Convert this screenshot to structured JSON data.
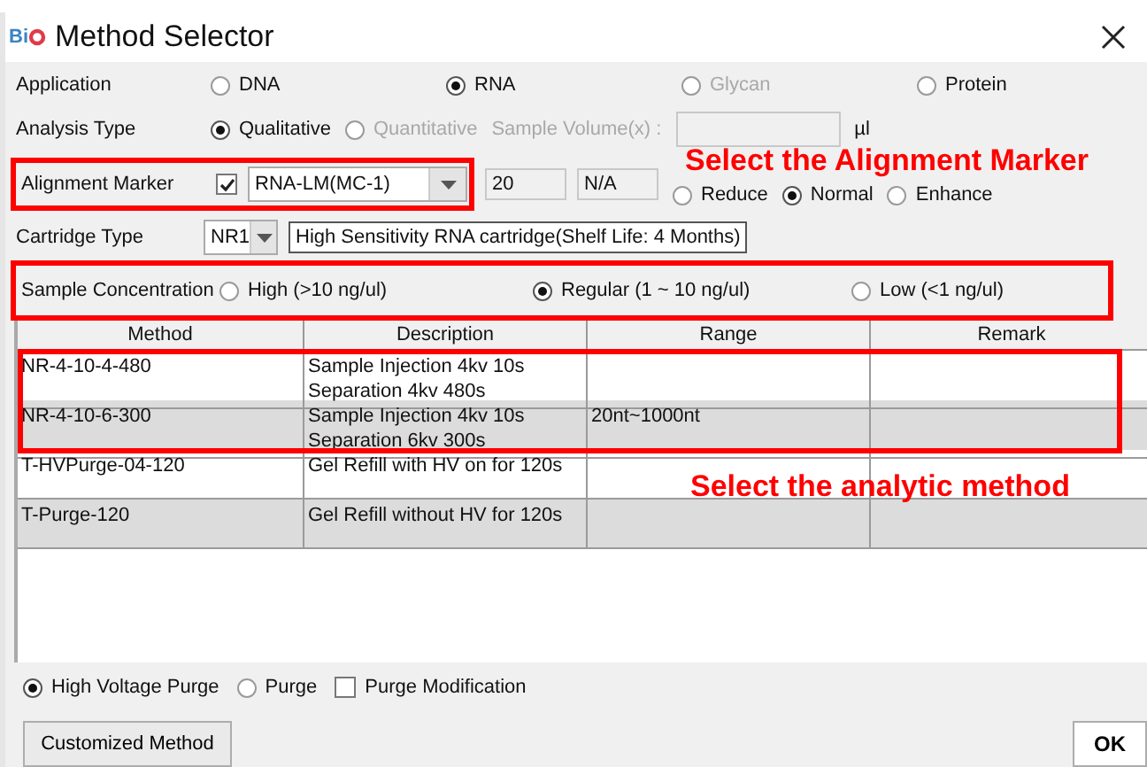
{
  "window": {
    "logo": "Bi",
    "title": "Method Selector"
  },
  "application": {
    "label": "Application",
    "options": [
      {
        "label": "DNA",
        "selected": false,
        "disabled": false
      },
      {
        "label": "RNA",
        "selected": true,
        "disabled": false
      },
      {
        "label": "Glycan",
        "selected": false,
        "disabled": true
      },
      {
        "label": "Protein",
        "selected": false,
        "disabled": false
      }
    ]
  },
  "analysis_type": {
    "label": "Analysis Type",
    "options": [
      {
        "label": "Qualitative",
        "selected": true,
        "disabled": false
      },
      {
        "label": "Quantitative",
        "selected": false,
        "disabled": true
      }
    ],
    "sample_volume": {
      "label": "Sample Volume(x) :",
      "disabled": true,
      "unit": "µl"
    }
  },
  "alignment_marker": {
    "label": "Alignment Marker",
    "highlighted": true,
    "checked": true,
    "marker": "RNA-LM(MC-1)",
    "value_1": "20",
    "value_2": "N/A",
    "options": [
      {
        "label": "Reduce",
        "selected": false
      },
      {
        "label": "Normal",
        "selected": true
      },
      {
        "label": "Enhance",
        "selected": false
      }
    ],
    "annotation": "Select the Alignment Marker"
  },
  "cartridge_type": {
    "label": "Cartridge Type",
    "type": "NR1",
    "description": "High Sensitivity RNA cartridge(Shelf Life: 4 Months)"
  },
  "sample_concentration": {
    "label": "Sample Concentration",
    "highlighted": true,
    "options": [
      {
        "label": "High (>10 ng/ul)",
        "selected": false
      },
      {
        "label": "Regular (1 ~ 10 ng/ul)",
        "selected": true
      },
      {
        "label": "Low (<1 ng/ul)",
        "selected": false
      }
    ]
  },
  "table": {
    "columns": [
      "Method",
      "Description",
      "Range",
      "Remark"
    ],
    "rows": [
      {
        "method": "NR-4-10-4-480",
        "description": [
          "Sample Injection 4kv 10s",
          "Separation 4kv 480s"
        ],
        "highlighted": true
      },
      {
        "method": "NR-4-10-6-300",
        "description": [
          "Sample Injection 4kv 10s",
          "Separation 6kv 300s"
        ],
        "range": "20nt~1000nt",
        "highlighted": true
      },
      {
        "method": "T-HVPurge-04-120",
        "description": [
          "Gel Refill with HV on for 120s"
        ],
        "highlighted": false
      },
      {
        "method": "T-Purge-120",
        "description": [
          "Gel Refill without HV for 120s"
        ],
        "highlighted": false
      }
    ],
    "annotation": "Select the analytic method"
  },
  "purge_options": [
    {
      "kind": "radio",
      "label": "High Voltage Purge",
      "selected": true
    },
    {
      "kind": "radio",
      "label": "Purge",
      "selected": false
    },
    {
      "kind": "checkbox",
      "label": "Purge Modification",
      "checked": false
    }
  ],
  "buttons": [
    {
      "label": "Customized Method"
    },
    {
      "label": "OK"
    }
  ]
}
